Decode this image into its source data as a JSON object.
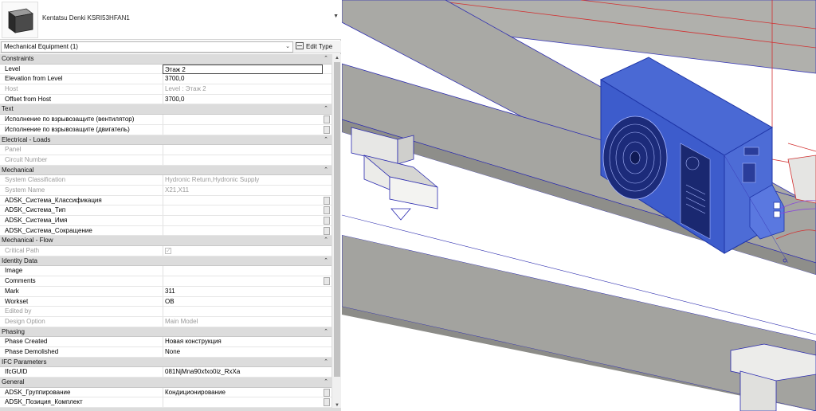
{
  "type_selector": {
    "family_type": "Kentatsu Denki KSRI53HFAN1",
    "thumbnail_icon": "equipment-box-icon"
  },
  "instance": {
    "filter_label": "Mechanical Equipment (1)",
    "edit_type_label": "Edit Type"
  },
  "properties": [
    {
      "kind": "group",
      "label": "Constraints"
    },
    {
      "kind": "prop",
      "name": "Level",
      "value": "Этаж 2",
      "editing": true
    },
    {
      "kind": "prop",
      "name": "Elevation from Level",
      "value": "3700,0"
    },
    {
      "kind": "prop",
      "name": "Host",
      "value": "Level : Этаж 2",
      "dim": true
    },
    {
      "kind": "prop",
      "name": "Offset from Host",
      "value": "3700,0"
    },
    {
      "kind": "group",
      "label": "Text"
    },
    {
      "kind": "prop",
      "name": "Исполнение по взрывозащите (вентилятор)",
      "value": "",
      "button": true
    },
    {
      "kind": "prop",
      "name": "Исполнение по взрывозащите (двигатель)",
      "value": "",
      "button": true
    },
    {
      "kind": "group",
      "label": "Electrical - Loads"
    },
    {
      "kind": "prop",
      "name": "Panel",
      "value": "",
      "dim": true
    },
    {
      "kind": "prop",
      "name": "Circuit Number",
      "value": "",
      "dim": true
    },
    {
      "kind": "group",
      "label": "Mechanical"
    },
    {
      "kind": "prop",
      "name": "System Classification",
      "value": "Hydronic Return,Hydronic Supply",
      "dim": true
    },
    {
      "kind": "prop",
      "name": "System Name",
      "value": "X21,X11",
      "dim": true
    },
    {
      "kind": "prop",
      "name": "ADSK_Система_Классификация",
      "value": "",
      "button": true
    },
    {
      "kind": "prop",
      "name": "ADSK_Система_Тип",
      "value": "",
      "button": true
    },
    {
      "kind": "prop",
      "name": "ADSK_Система_Имя",
      "value": "",
      "button": true
    },
    {
      "kind": "prop",
      "name": "ADSK_Система_Сокращение",
      "value": "",
      "button": true
    },
    {
      "kind": "group",
      "label": "Mechanical - Flow"
    },
    {
      "kind": "prop",
      "name": "Critical Path",
      "value": "",
      "dim": true,
      "checkbox": true
    },
    {
      "kind": "group",
      "label": "Identity Data"
    },
    {
      "kind": "prop",
      "name": "Image",
      "value": ""
    },
    {
      "kind": "prop",
      "name": "Comments",
      "value": "",
      "button": true
    },
    {
      "kind": "prop",
      "name": "Mark",
      "value": "311"
    },
    {
      "kind": "prop",
      "name": "Workset",
      "value": "OB"
    },
    {
      "kind": "prop",
      "name": "Edited by",
      "value": "",
      "dim": true
    },
    {
      "kind": "prop",
      "name": "Design Option",
      "value": "Main Model",
      "dim": true
    },
    {
      "kind": "group",
      "label": "Phasing"
    },
    {
      "kind": "prop",
      "name": "Phase Created",
      "value": "Новая конструкция"
    },
    {
      "kind": "prop",
      "name": "Phase Demolished",
      "value": "None"
    },
    {
      "kind": "group",
      "label": "IFC Parameters"
    },
    {
      "kind": "prop",
      "name": "IfcGUID",
      "value": "081NjMna90xfxo0iz_RxXa"
    },
    {
      "kind": "group",
      "label": "General"
    },
    {
      "kind": "prop",
      "name": "ADSK_Группирование",
      "value": "Кондиционирование",
      "button": true
    },
    {
      "kind": "prop",
      "name": "ADSK_Позиция_Комплект",
      "value": "",
      "button": true
    }
  ],
  "colors": {
    "selection_blue": "#2f54d8",
    "unit_fill": "#3e5fcf",
    "beam_gray": "#a8a8a4",
    "beam_dark": "#8a8a86",
    "edge_red": "#d23030"
  }
}
